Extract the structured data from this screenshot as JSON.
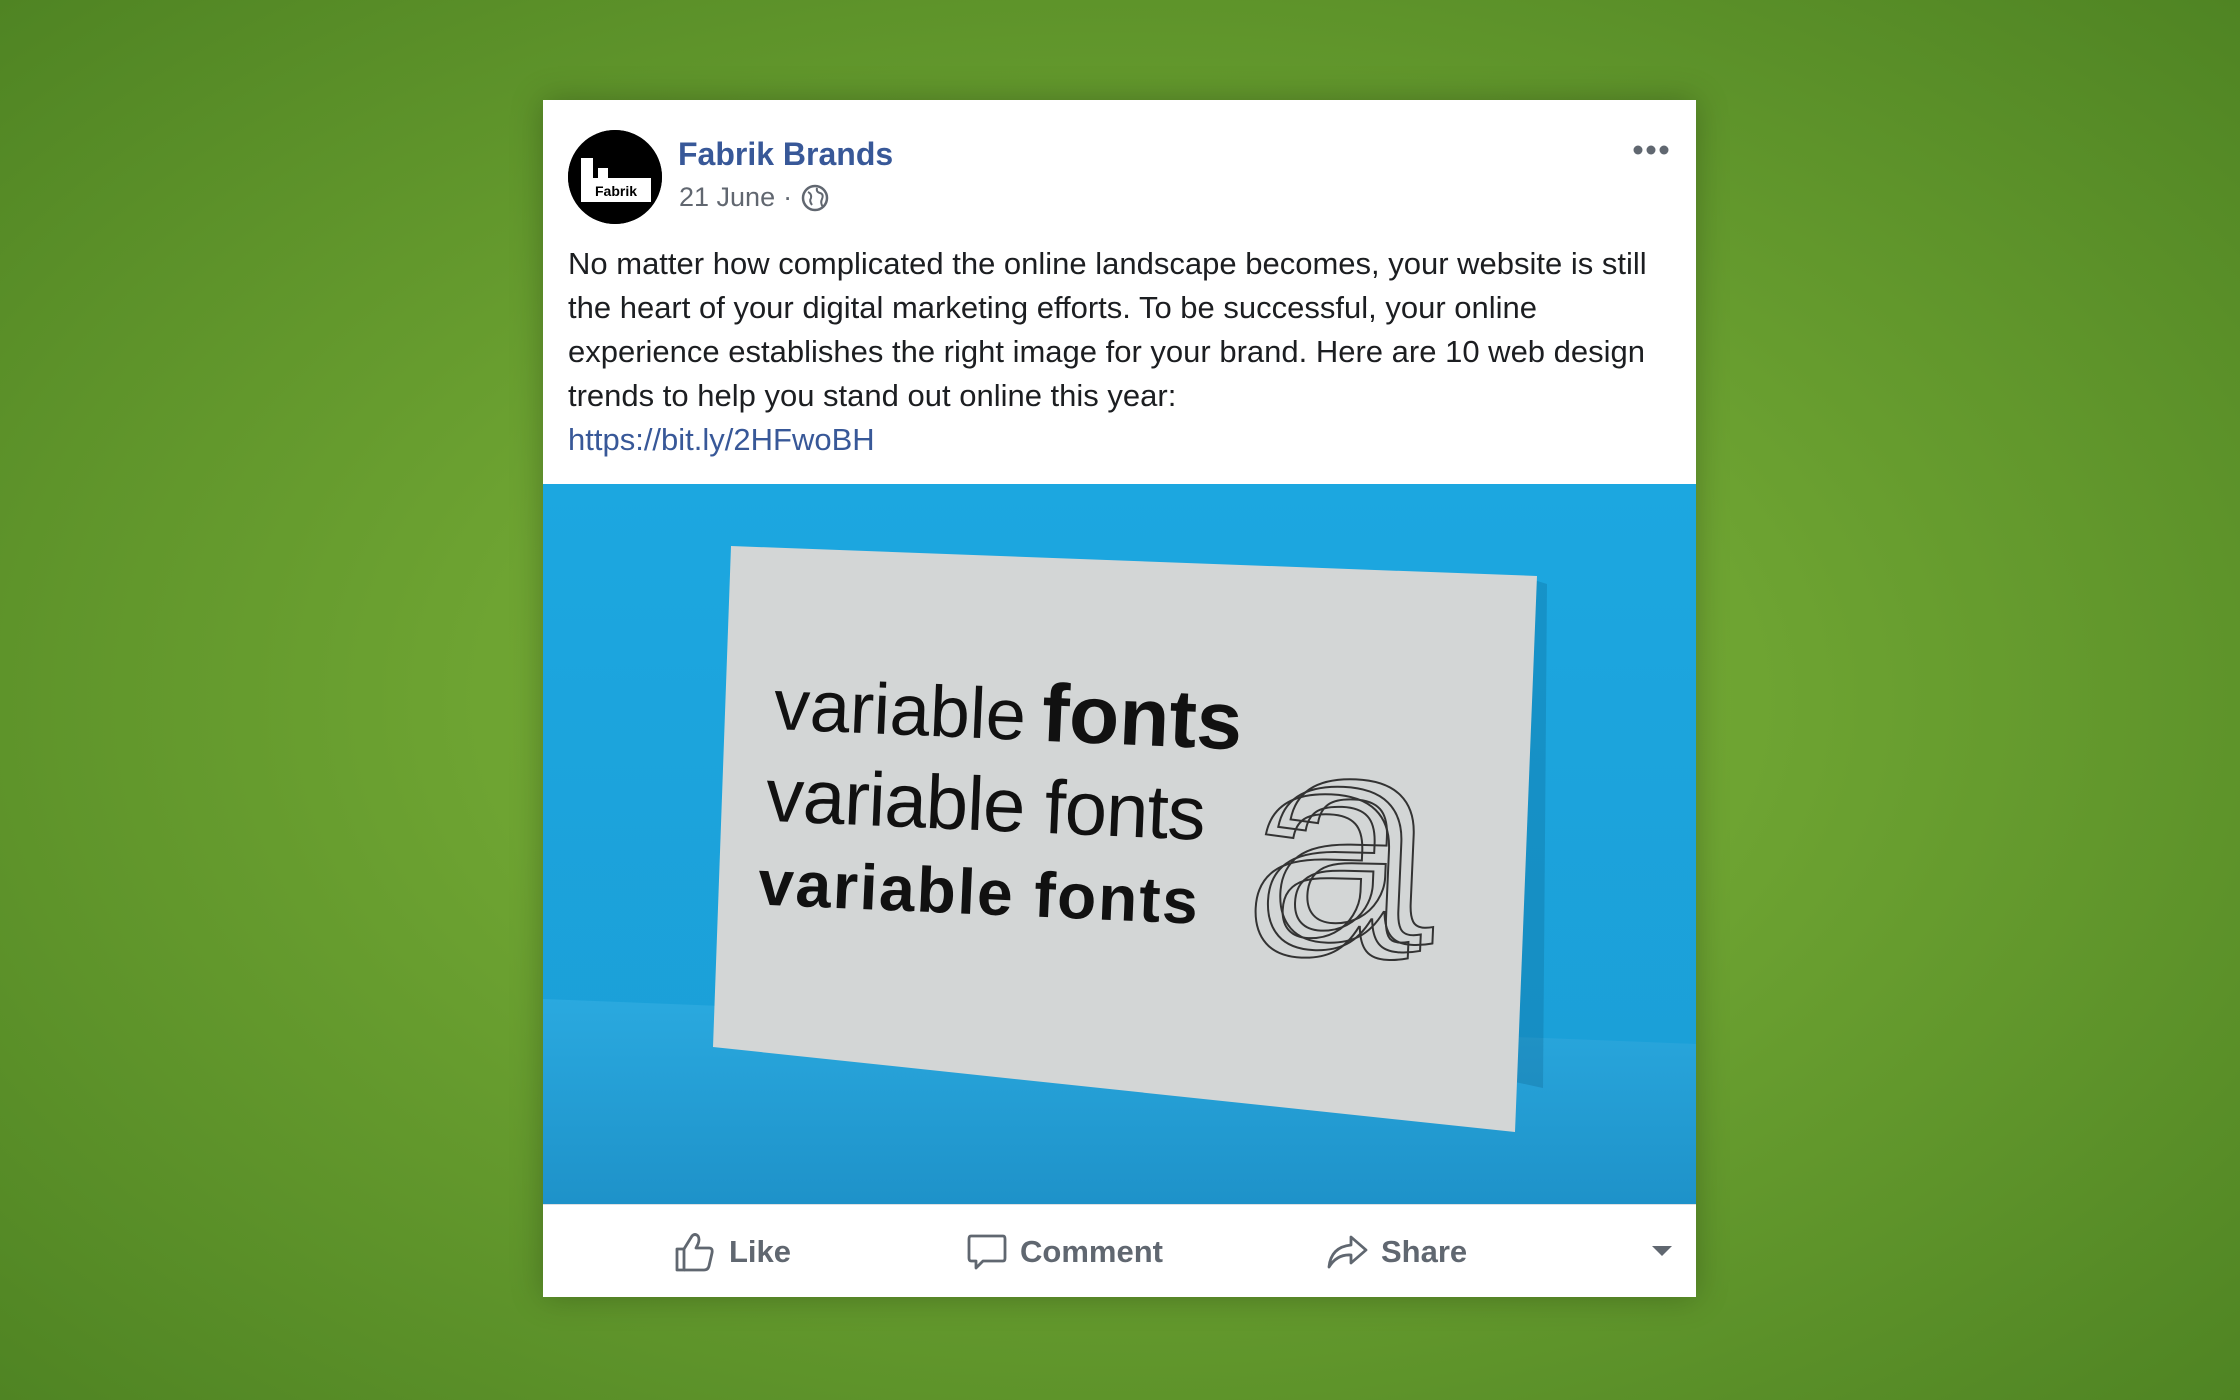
{
  "post": {
    "author": "Fabrik Brands",
    "avatar_text": "Fabrik",
    "date": "21 June",
    "separator": "·",
    "text": "No matter how complicated the online landscape becomes, your website is still the heart of your digital marketing efforts. To be successful, your online experience establishes the right image for your brand. Here are 10 web design trends to help you stand out online this year:",
    "link": "https://bit.ly/2HFwoBH"
  },
  "image": {
    "line1_light": "variable",
    "line1_bold": "fonts",
    "line2": "variable fonts",
    "line3": "variable fonts",
    "glyph": "a"
  },
  "actions": {
    "like": "Like",
    "comment": "Comment",
    "share": "Share"
  },
  "colors": {
    "background": "#6ea432",
    "link": "#385898",
    "image_background": "#1aa6dc",
    "card": "#d3d6d6"
  }
}
